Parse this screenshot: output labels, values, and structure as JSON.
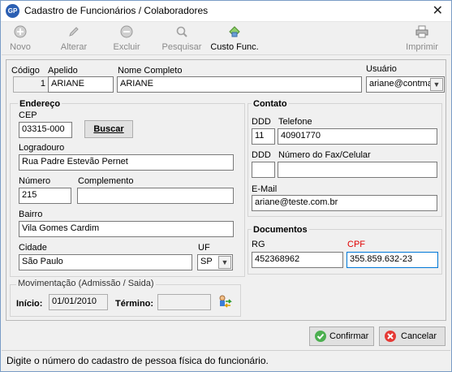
{
  "window": {
    "title": "Cadastro de Funcionários / Colaboradores",
    "app_icon_text": "GP"
  },
  "toolbar": {
    "novo": "Novo",
    "alterar": "Alterar",
    "excluir": "Excluir",
    "pesquisar": "Pesquisar",
    "custo": "Custo Func.",
    "imprimir": "Imprimir"
  },
  "header": {
    "codigo_label": "Código",
    "codigo_value": "1",
    "apelido_label": "Apelido",
    "apelido_value": "ARIANE",
    "nome_label": "Nome Completo",
    "nome_value": "ARIANE",
    "usuario_label": "Usuário",
    "usuario_value": "ariane@contma"
  },
  "endereco": {
    "title": "Endereço",
    "cep_label": "CEP",
    "cep_value": "03315-000",
    "buscar_label": "Buscar",
    "logradouro_label": "Logradouro",
    "logradouro_value": "Rua Padre Estevão Pernet",
    "numero_label": "Número",
    "numero_value": "215",
    "complemento_label": "Complemento",
    "complemento_value": "",
    "bairro_label": "Bairro",
    "bairro_value": "Vila Gomes Cardim",
    "cidade_label": "Cidade",
    "cidade_value": "São Paulo",
    "uf_label": "UF",
    "uf_value": "SP"
  },
  "movimentacao": {
    "title": "Movimentação (Admissão / Saida)",
    "inicio_label": "Início:",
    "inicio_value": "01/01/2010",
    "termino_label": "Término:",
    "termino_value": ""
  },
  "contato": {
    "title": "Contato",
    "ddd_label": "DDD",
    "telefone_label": "Telefone",
    "ddd_value": "11",
    "telefone_value": "40901770",
    "ddd_fax_label": "DDD",
    "fax_label": "Número do Fax/Celular",
    "ddd_fax_value": "",
    "fax_value": "",
    "email_label": "E-Mail",
    "email_value": "ariane@teste.com.br"
  },
  "documentos": {
    "title": "Documentos",
    "rg_label": "RG",
    "rg_value": "452368962",
    "cpf_label": "CPF",
    "cpf_value": "355.859.632-23"
  },
  "actions": {
    "confirmar": "Confirmar",
    "cancelar": "Cancelar"
  },
  "status": {
    "text": "Digite o número do cadastro de pessoa física do funcionário."
  },
  "colors": {
    "cpf_label": "#e00000",
    "accent": "#0078d7"
  }
}
